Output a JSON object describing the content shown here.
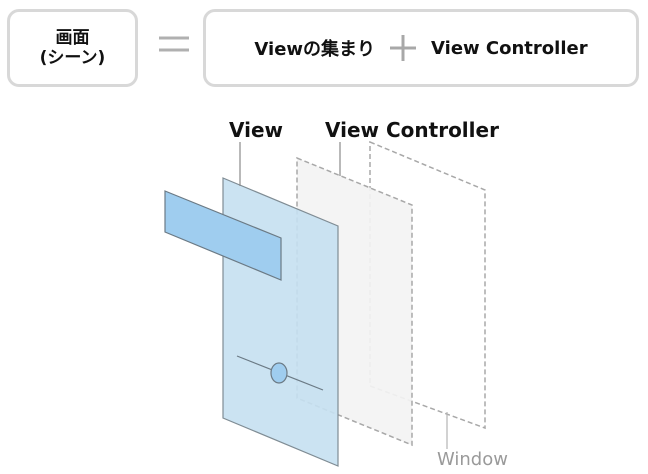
{
  "equation": {
    "screen_line1": "画面",
    "screen_line2": "(シーン)",
    "views_collection": "Viewの集まり",
    "view_controller": "View Controller"
  },
  "diagram": {
    "view_label": "View",
    "view_controller_label": "View Controller",
    "window_label": "Window"
  },
  "colors": {
    "view_fill": "#c5e0f1",
    "subview_fill": "#9fcdef",
    "vc_fill": "#f3f3f3",
    "border_gray": "#d8d8d8"
  }
}
